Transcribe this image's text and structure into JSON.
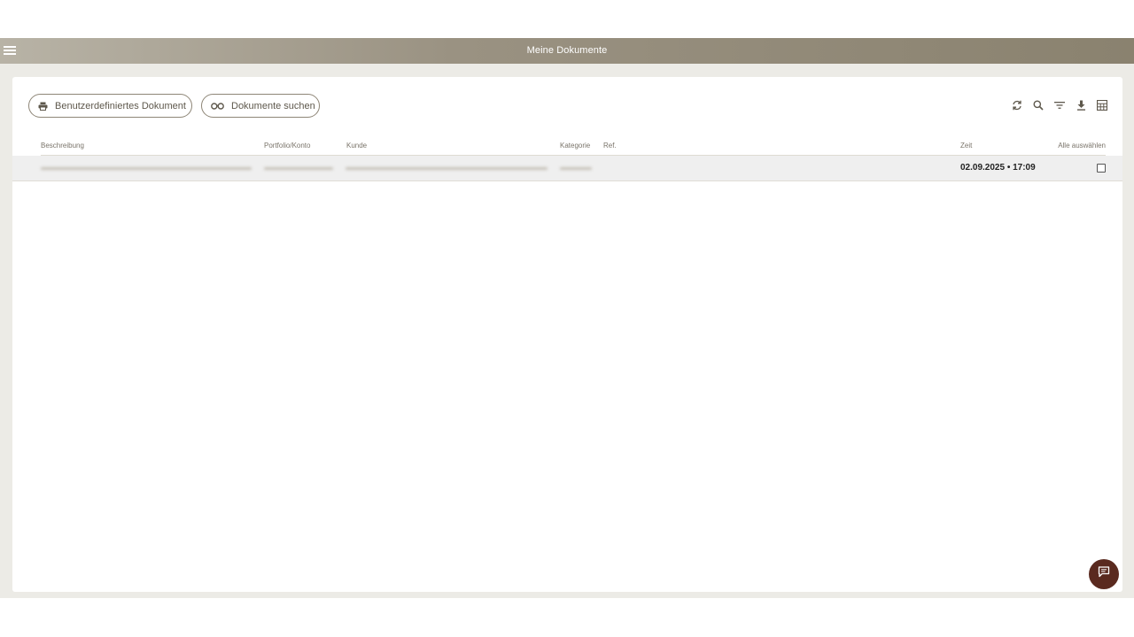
{
  "header": {
    "title": "Meine Dokumente",
    "menu_icon": "hamburger-menu-icon",
    "background_start": "#b8b3a6",
    "background_end": "#8a826f"
  },
  "actions": {
    "custom_document_label": "Benutzerdefiniertes Dokument",
    "custom_document_icon": "printer-icon",
    "search_documents_label": "Dokumente suchen",
    "search_documents_icon": "glasses-icon"
  },
  "toolbar": {
    "icons": [
      "refresh-icon",
      "search-icon",
      "filter-icon",
      "download-icon",
      "grid-view-icon"
    ]
  },
  "table": {
    "columns": {
      "description": "Beschreibung",
      "portfolio": "Portfolio/Konto",
      "customer": "Kunde",
      "category": "Kategorie",
      "ref": "Ref.",
      "time": "Zeit",
      "select_all": "Alle auswählen"
    },
    "rows": [
      {
        "time": "02.09.2025 • 17:09",
        "selected": false
      }
    ]
  },
  "chat": {
    "icon": "chat-icon",
    "color": "#5a2a1f"
  }
}
